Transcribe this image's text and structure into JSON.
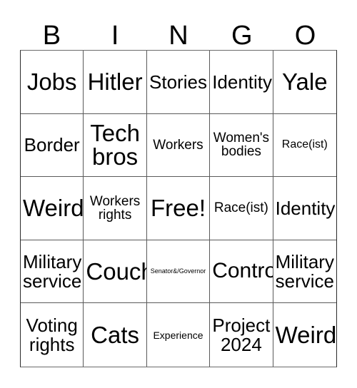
{
  "card": {
    "header_letters": [
      "B",
      "I",
      "N",
      "G",
      "O"
    ],
    "rows": [
      [
        {
          "text": "Jobs",
          "size": "sz-xxl"
        },
        {
          "text": "Hitler",
          "size": "sz-xxl"
        },
        {
          "text": "Stories",
          "size": "sz-l"
        },
        {
          "text": "Identity",
          "size": "sz-l"
        },
        {
          "text": "Yale",
          "size": "sz-xxl"
        }
      ],
      [
        {
          "text": "Border",
          "size": "sz-l"
        },
        {
          "text": "Tech\nbros",
          "size": "sz-xxl"
        },
        {
          "text": "Workers",
          "size": "sz-m"
        },
        {
          "text": "Women's\nbodies",
          "size": "sz-m"
        },
        {
          "text": "Race(ist)",
          "size": "sz-s"
        }
      ],
      [
        {
          "text": "Weird",
          "size": "sz-xxl"
        },
        {
          "text": "Workers\nrights",
          "size": "sz-m"
        },
        {
          "text": "Free!",
          "size": "sz-xxl"
        },
        {
          "text": "Race(ist)",
          "size": "sz-m"
        },
        {
          "text": "Identity",
          "size": "sz-l"
        }
      ],
      [
        {
          "text": "Military\nservice",
          "size": "sz-l"
        },
        {
          "text": "Couch",
          "size": "sz-xxl"
        },
        {
          "text": "Senator&/Governor",
          "size": "sz-xxs"
        },
        {
          "text": "Control",
          "size": "sz-xl"
        },
        {
          "text": "Military\nservice",
          "size": "sz-l"
        }
      ],
      [
        {
          "text": "Voting\nrights",
          "size": "sz-l"
        },
        {
          "text": "Cats",
          "size": "sz-xxl"
        },
        {
          "text": "Experience",
          "size": "sz-xs"
        },
        {
          "text": "Project\n2024",
          "size": "sz-l"
        },
        {
          "text": "Weird",
          "size": "sz-xxl"
        }
      ]
    ],
    "colors": {
      "background": "#ffffff",
      "text": "#000000",
      "grid_line": "#5a5a5a",
      "grid_border": "#2b2b2b"
    }
  }
}
